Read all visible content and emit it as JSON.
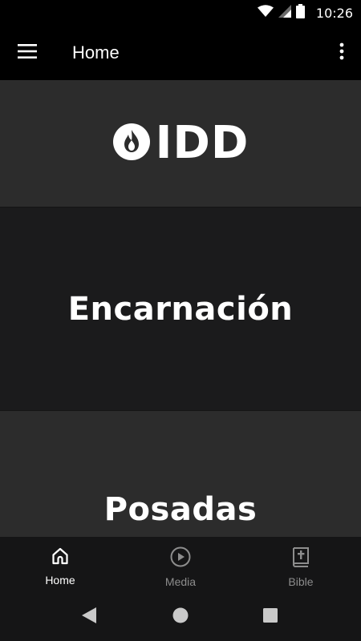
{
  "status_bar": {
    "time": "10:26",
    "icons": [
      "wifi-icon",
      "signal-icon",
      "battery-icon"
    ]
  },
  "app_bar": {
    "title": "Home",
    "menu_icon": "hamburger-menu-icon",
    "overflow_icon": "more-vertical-icon"
  },
  "cards": {
    "logo_text": "IDD",
    "logo_icon": "flame-in-circle-icon",
    "encarnacion": "Encarnación",
    "posadas": "Posadas"
  },
  "bottom_nav": {
    "items": [
      {
        "label": "Home",
        "icon": "home-icon",
        "active": true
      },
      {
        "label": "Media",
        "icon": "play-circle-icon",
        "active": false
      },
      {
        "label": "Bible",
        "icon": "bible-icon",
        "active": false
      }
    ]
  },
  "system_nav": {
    "icons": [
      "back-triangle-icon",
      "home-circle-icon",
      "recents-square-icon"
    ]
  },
  "colors": {
    "background": "#000000",
    "card_light": "#2c2c2c",
    "card_dark": "#1b1b1c",
    "nav_background": "#151516",
    "active": "#ffffff",
    "inactive": "#8d8d8d"
  }
}
